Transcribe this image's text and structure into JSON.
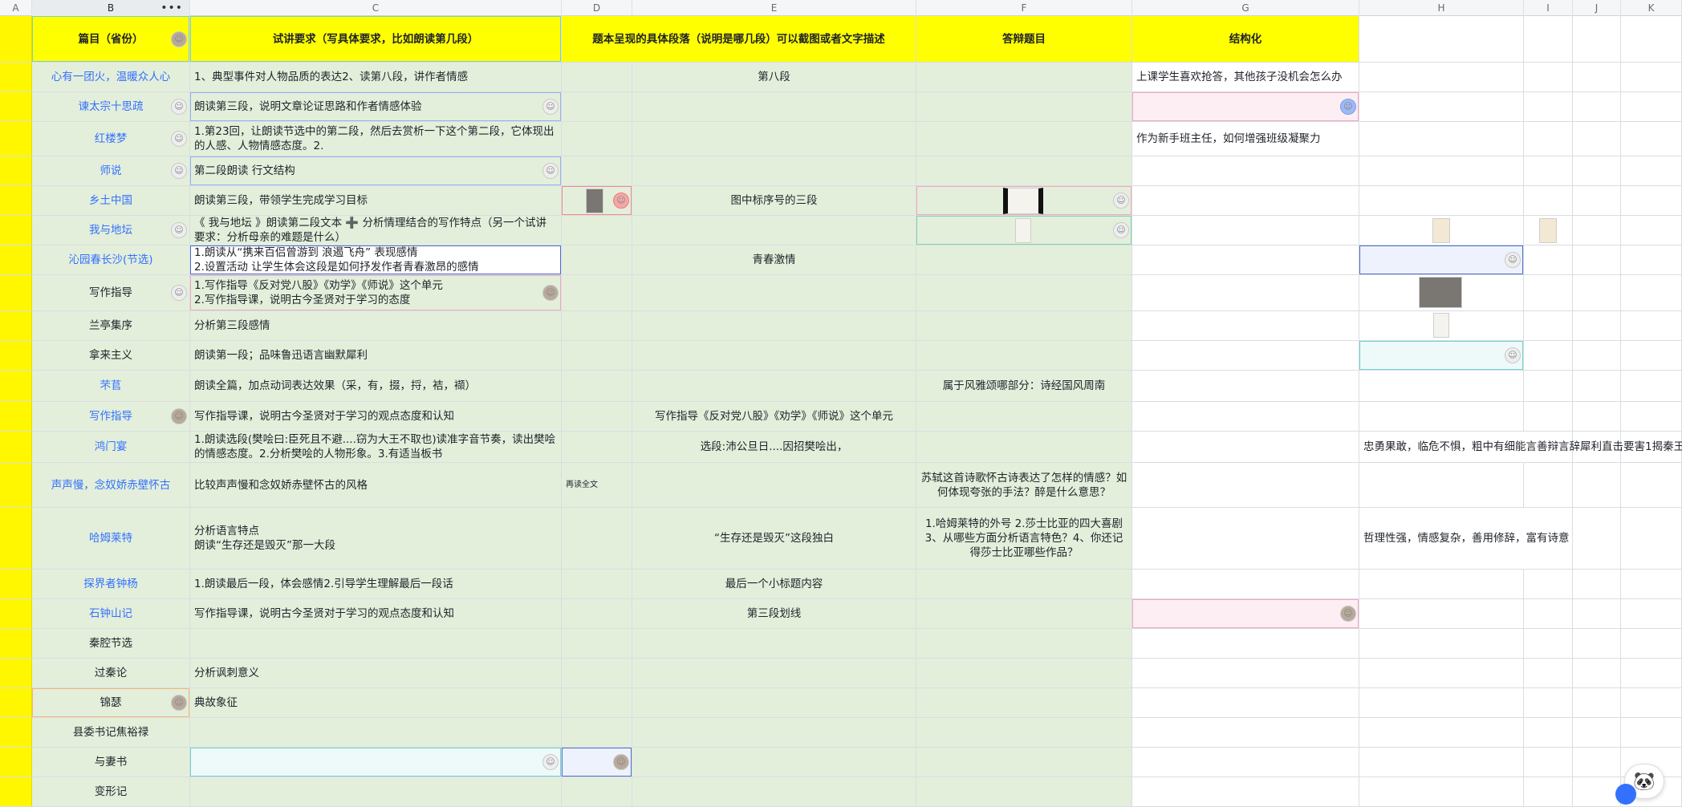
{
  "columns": [
    "A",
    "B",
    "C",
    "D",
    "E",
    "F",
    "G",
    "H",
    "I",
    "J",
    "K"
  ],
  "column_menu_icon": "more-dots-icon",
  "headers": {
    "B": "篇目（省份）",
    "C": "试讲要求（写具体要求，比如朗读第几段）",
    "DE": "题本呈现的具体段落（说明是哪几段）可以截图或者文字描述",
    "F": "答辩题目",
    "G": "结构化"
  },
  "rows": [
    {
      "B": "心有一团火，温暖众人心",
      "C": "1、典型事件对人物品质的表达2、读第八段，讲作者情感",
      "E": "第八段",
      "F": "",
      "G": "上课学生喜欢抢答，其他孩子没机会怎么办",
      "H": ""
    },
    {
      "B": "谏太宗十思疏",
      "C": "朗读第三段，说明文章论证思路和作者情感体验",
      "E": "",
      "F": "",
      "G": "",
      "H": ""
    },
    {
      "B": "红楼梦",
      "C": "1.第23回，让朗读节选中的第二段，然后去赏析一下这个第二段，它体现出的人感、人物情感态度。2.",
      "E": "",
      "F": "",
      "G": "作为新手班主任，如何增强班级凝聚力",
      "H": ""
    },
    {
      "B": "师说",
      "C": "第二段朗读  行文结构",
      "E": "",
      "F": "",
      "G": "",
      "H": ""
    },
    {
      "B": "乡土中国",
      "C": "朗读第三段，带领学生完成学习目标",
      "E": "图中标序号的三段",
      "F": "",
      "G": "",
      "H": ""
    },
    {
      "B": "我与地坛",
      "C": "《 我与地坛 》朗读第二段文本 ➕ 分析情理结合的写作特点（另一个试讲要求：分析母亲的难题是什么）",
      "E": "",
      "F": "",
      "G": "",
      "H": ""
    },
    {
      "B": "沁园春长沙(节选)",
      "C": "1.朗读从“携来百侣曾游到 浪遏飞舟” 表现感情\n2.设置活动 让学生体会这段是如何抒发作者青春激昂的感情",
      "E": "青春激情",
      "F": "",
      "G": "",
      "H": ""
    },
    {
      "B": "写作指导",
      "C": "1.写作指导《反对党八股》《劝学》《师说》这个单元\n2.写作指导课，说明古今圣贤对于学习的态度",
      "E": "",
      "F": "",
      "G": "",
      "H": ""
    },
    {
      "B": "兰亭集序",
      "C": "分析第三段感情",
      "E": "",
      "F": "",
      "G": "",
      "H": ""
    },
    {
      "B": "拿来主义",
      "C": "朗读第一段；品味鲁迅语言幽默犀利",
      "E": "",
      "F": "",
      "G": "",
      "H": ""
    },
    {
      "B": "芣苢",
      "C": "朗读全篇，加点动词表达效果（采，有，掇，捋，袺，襭）",
      "E": "",
      "F": "属于风雅颂哪部分：诗经国风周南",
      "G": "",
      "H": ""
    },
    {
      "B": "写作指导",
      "C": "写作指导课，说明古今圣贤对于学习的观点态度和认知",
      "E": "写作指导《反对党八股》《劝学》《师说》这个单元",
      "F": "",
      "G": "",
      "H": ""
    },
    {
      "B": "鸿门宴",
      "C": "1.朗读选段(樊哙曰:臣死且不避....窃为大王不取也)读准字音节奏，读出樊哙的情感态度。2.分析樊哙的人物形象。3.有适当板书",
      "E": "选段:沛公旦日....因招樊哙出，",
      "F": "",
      "G": "",
      "H": "忠勇果敢，临危不惧，粗中有细能言善辩言辞犀利直击要害1揭秦王"
    },
    {
      "B": "声声慢，念奴娇赤壁怀古",
      "C": "比较声声慢和念奴娇赤壁怀古的风格",
      "D": "再读全文",
      "E": "",
      "F": "苏轼这首诗歌怀古诗表达了怎样的情感？如何体现夸张的手法？醉是什么意思？",
      "G": "",
      "H": ""
    },
    {
      "B": "哈姆莱特",
      "C": "分析语言特点\n朗读“生存还是毁灭”那一大段",
      "E": "“生存还是毁灭”这段独白",
      "F": "1.哈姆莱特的外号 2.莎士比亚的四大喜剧 3、从哪些方面分析语言特色？4、你还记得莎士比亚哪些作品？",
      "G": "",
      "H": "哲理性强，情感复杂，善用修辞，富有诗意"
    },
    {
      "B": "探界者钟杨",
      "C": "1.朗读最后一段，体会感情2.引导学生理解最后一段话",
      "E": "最后一个小标题内容",
      "F": "",
      "G": "",
      "H": ""
    },
    {
      "B": "石钟山记",
      "C": "写作指导课，说明古今圣贤对于学习的观点态度和认知",
      "E": "第三段划线",
      "F": "",
      "G": "",
      "H": ""
    },
    {
      "B": "秦腔节选",
      "C": "",
      "E": "",
      "F": "",
      "G": "",
      "H": ""
    },
    {
      "B": "过秦论",
      "C": "分析讽刺意义",
      "E": "",
      "F": "",
      "G": "",
      "H": ""
    },
    {
      "B": "锦瑟",
      "C": "典故象征",
      "E": "",
      "F": "",
      "G": "",
      "H": ""
    },
    {
      "B": "县委书记焦裕禄",
      "C": "",
      "E": "",
      "F": "",
      "G": "",
      "H": ""
    },
    {
      "B": "与妻书",
      "C": "",
      "E": "",
      "F": "",
      "G": "",
      "H": ""
    },
    {
      "B": "变形记",
      "C": "",
      "E": "",
      "F": "",
      "G": "",
      "H": ""
    }
  ],
  "icons": {
    "avatar": "user-avatar-icon",
    "image_thumbnail": "image-thumbnail-icon",
    "assistant": "assistant-mascot-icon"
  },
  "colors": {
    "header_yellow": "#ffff00",
    "link_blue": "#3370ff",
    "green_fill": "#e3efdb"
  }
}
